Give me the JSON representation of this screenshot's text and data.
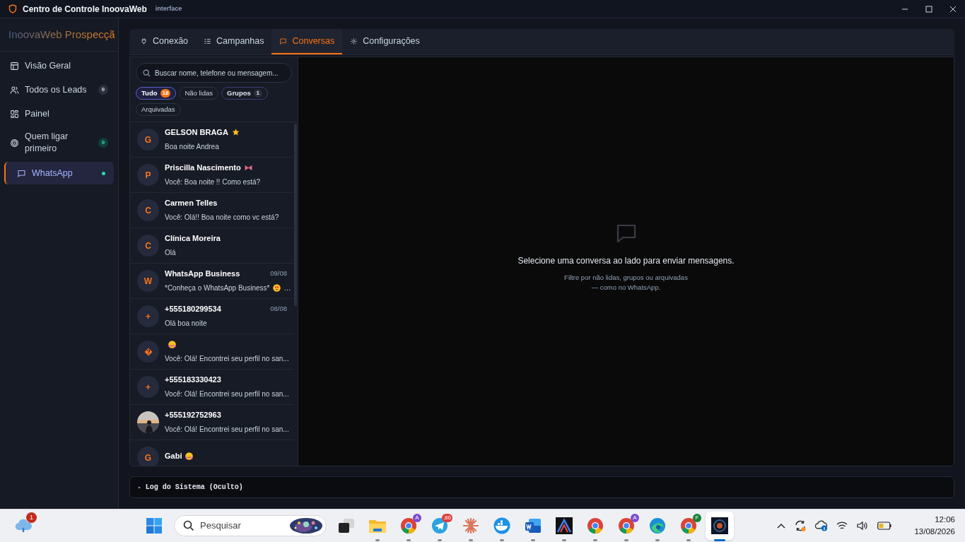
{
  "window": {
    "title": "Centro de Controle InoovaWeb",
    "subtitle": "interface"
  },
  "sidebar": {
    "brand": "InoovaWeb Prospecçã",
    "items": [
      {
        "label": "Visão Geral",
        "selected": false
      },
      {
        "label": "Todos os Leads",
        "badge": {
          "text": "0",
          "color": "#2a2f3c"
        },
        "selected": false
      },
      {
        "label": "Painel",
        "selected": false
      },
      {
        "label": "Quem ligar primeiro",
        "badge": {
          "text": "0",
          "color": "#123d3a"
        },
        "selected": false
      },
      {
        "label": "WhatsApp",
        "badge": {
          "color": "#2dd4bf"
        },
        "selected": true
      }
    ]
  },
  "tabs": [
    {
      "label": "Conexão",
      "selected": false
    },
    {
      "label": "Campanhas",
      "selected": false
    },
    {
      "label": "Conversas",
      "selected": true
    },
    {
      "label": "Configurações",
      "selected": false
    }
  ],
  "search": {
    "placeholder": "Buscar nome, telefone ou mensagem..."
  },
  "filters": [
    {
      "label": "Tudo",
      "count": "18",
      "selected": true
    },
    {
      "label": "Não lidas",
      "selected": false
    },
    {
      "label": "Grupos",
      "count": "1",
      "selected": false
    },
    {
      "label": "Arquivadas",
      "selected": false
    }
  ],
  "conversations": [
    {
      "kind": "text",
      "avatar": "G",
      "name": "GELSON BRAGA",
      "preview": "Boa noite Andrea"
    },
    {
      "kind": "text",
      "avatar": "P",
      "name": "Priscilla Nascimento",
      "preview": "Você: Boa noite !! Como está?"
    },
    {
      "kind": "text",
      "avatar": "C",
      "name": "Carmen Telles",
      "preview": "Você: Olá!! Boa noite como vc está?"
    },
    {
      "kind": "text",
      "avatar": "C",
      "name": "Clínica Moreira",
      "preview": "Olá"
    },
    {
      "kind": "text",
      "avatar": "W",
      "name": "WhatsApp Business",
      "time": "09/08",
      "preview": "*Conheça o WhatsApp Business*",
      "preview_tail": "…"
    },
    {
      "kind": "text",
      "avatar": "+",
      "name": "+555180299534",
      "time": "08/08",
      "preview": "Olá boa noite"
    },
    {
      "kind": "symbol",
      "preview": "Você: Olá! Encontrei seu perfil no san..."
    },
    {
      "kind": "text",
      "avatar": "+",
      "name": "+555183330423",
      "preview": "Você: Olá! Encontrei seu perfil no san..."
    },
    {
      "kind": "picture",
      "name": "+555192752963",
      "preview": "Você: Olá! Encontrei seu perfil no san..."
    },
    {
      "kind": "text",
      "avatar": "G",
      "name": "Gabi"
    }
  ],
  "empty_state": {
    "title": "Selecione uma conversa ao lado para enviar mensagens.",
    "hint_lines": [
      "Filtre por não lidas, grupos ou arquivadas",
      "— como no WhatsApp."
    ]
  },
  "log": {
    "marker": "▸",
    "label": "Log do Sistema (Oculto)"
  },
  "taskbar": {
    "search_placeholder": "Pesquisar",
    "weather_badge": "1",
    "apps": [
      {
        "kind": "windows",
        "selected": false
      },
      {
        "kind": "taskview",
        "selected": false
      },
      {
        "kind": "folder",
        "selected": false,
        "running": true
      },
      {
        "kind": "browser",
        "badge": "A",
        "selected": false,
        "running": true
      },
      {
        "kind": "plane",
        "badge": ".86",
        "selected": false,
        "running": true
      },
      {
        "kind": "sparkle",
        "selected": false,
        "running": true
      },
      {
        "kind": "whale",
        "selected": false,
        "running": true
      },
      {
        "kind": "word",
        "selected": false,
        "running": true
      },
      {
        "kind": "peak",
        "selected": false,
        "running": true
      },
      {
        "kind": "browser",
        "selected": false,
        "running": true
      },
      {
        "kind": "browser",
        "badge": "A",
        "selected": false,
        "running": true
      },
      {
        "kind": "wave",
        "selected": false,
        "running": true
      },
      {
        "kind": "browser",
        "badge": "F",
        "selected": false,
        "running": true
      },
      {
        "kind": "lens",
        "selected": true,
        "running": true
      }
    ],
    "time": "12:06",
    "date": "13/08/2026"
  }
}
